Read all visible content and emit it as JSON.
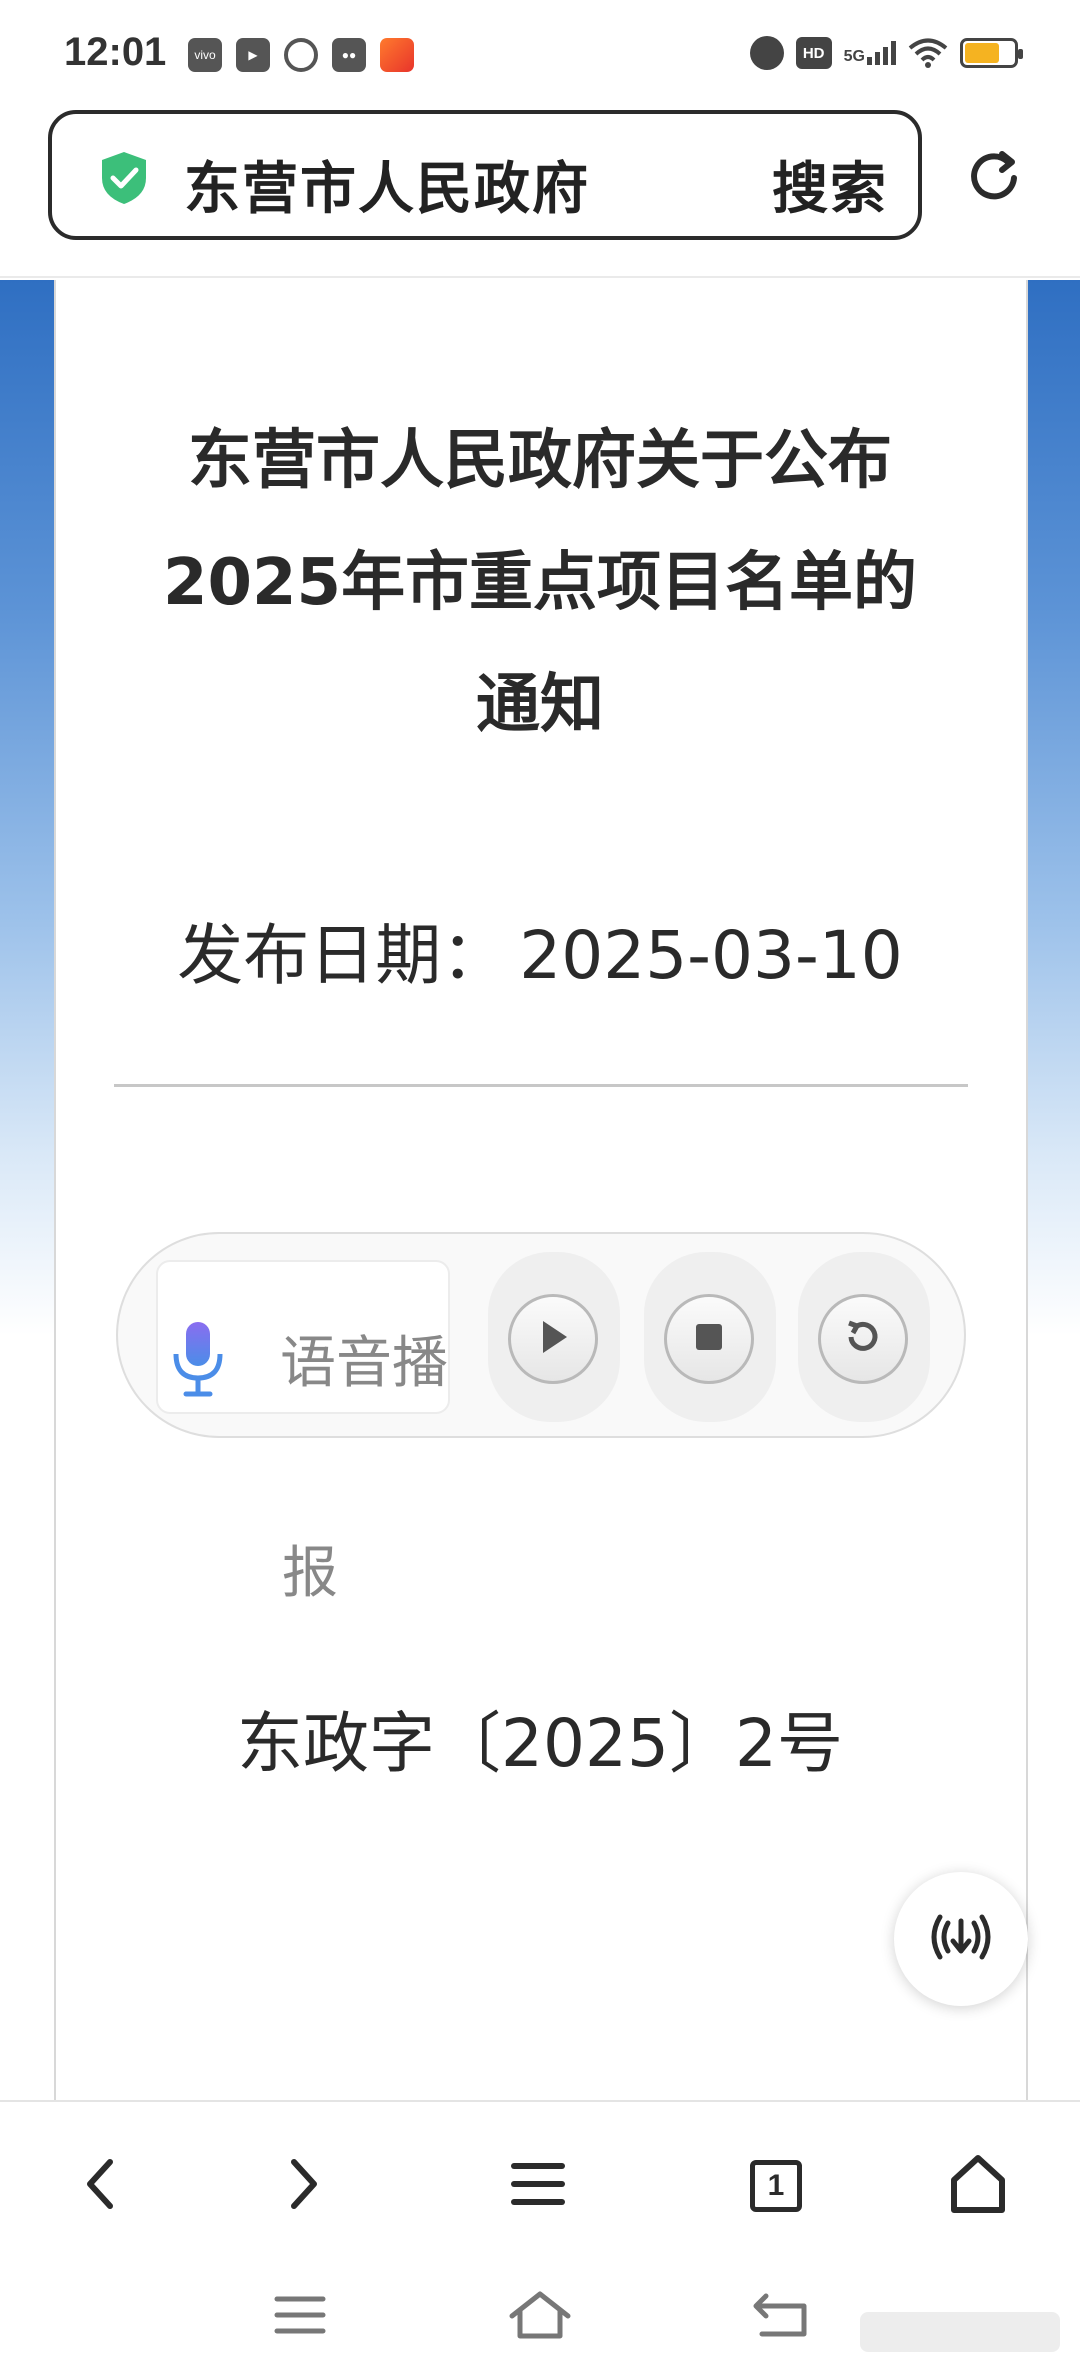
{
  "status_bar": {
    "time": "12:01",
    "notification_icons": [
      "vivo",
      "iqiyi-icon",
      "bank-icon",
      "wechat-icon",
      "app-icon"
    ],
    "hd_badge": "HD",
    "network": "5G",
    "battery_color": "#f5b321"
  },
  "address_bar": {
    "site_title": "东营市人民政府",
    "search_label": "搜索",
    "secure_icon_color": "#3cbf7a"
  },
  "document": {
    "title_lines": [
      "东营市人民政府关于公布",
      "2025年市重点项目名单的",
      "通知"
    ],
    "publish_date_label": "发布日期：",
    "publish_date": "2025-03-10",
    "doc_number": "东政字〔2025〕2号"
  },
  "voice_player": {
    "label_part1": "语音播",
    "label_part2": "报",
    "mic_color": "#6b7fe8"
  },
  "bottom_toolbar": {
    "tab_count": "1"
  },
  "colors": {
    "edge_gradient_top": "#2f6fc2",
    "text": "#2a2a2a"
  }
}
